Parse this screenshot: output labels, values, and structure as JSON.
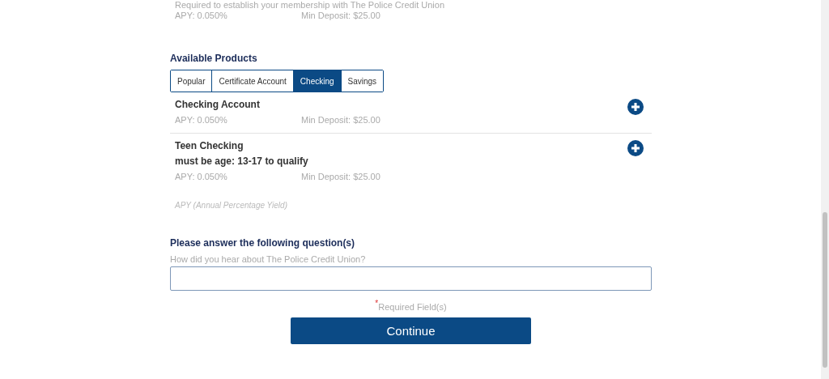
{
  "previous_product": {
    "note": "Required to establish your membership with The Police Credit Union",
    "apy": "APY: 0.050%",
    "min_deposit": "Min Deposit: $25.00"
  },
  "available_products": {
    "heading": "Available Products",
    "tabs": [
      {
        "label": "Popular",
        "selected": false
      },
      {
        "label": "Certificate Account",
        "selected": false
      },
      {
        "label": "Checking",
        "selected": true
      },
      {
        "label": "Savings",
        "selected": false
      }
    ],
    "products": [
      {
        "name": "Checking Account",
        "apy": "APY: 0.050%",
        "min_deposit": "Min Deposit: $25.00"
      },
      {
        "name": "Teen Checking",
        "requirement": "must be age: 13-17 to qualify",
        "apy": "APY: 0.050%",
        "min_deposit": "Min Deposit: $25.00"
      }
    ],
    "footnote": "APY (Annual Percentage Yield)"
  },
  "questions": {
    "heading": "Please answer the following question(s)",
    "question": "How did you hear about The Police Credit Union?",
    "required_mark": "*",
    "required_note": "Required Field(s)"
  },
  "continue_button": "Continue"
}
